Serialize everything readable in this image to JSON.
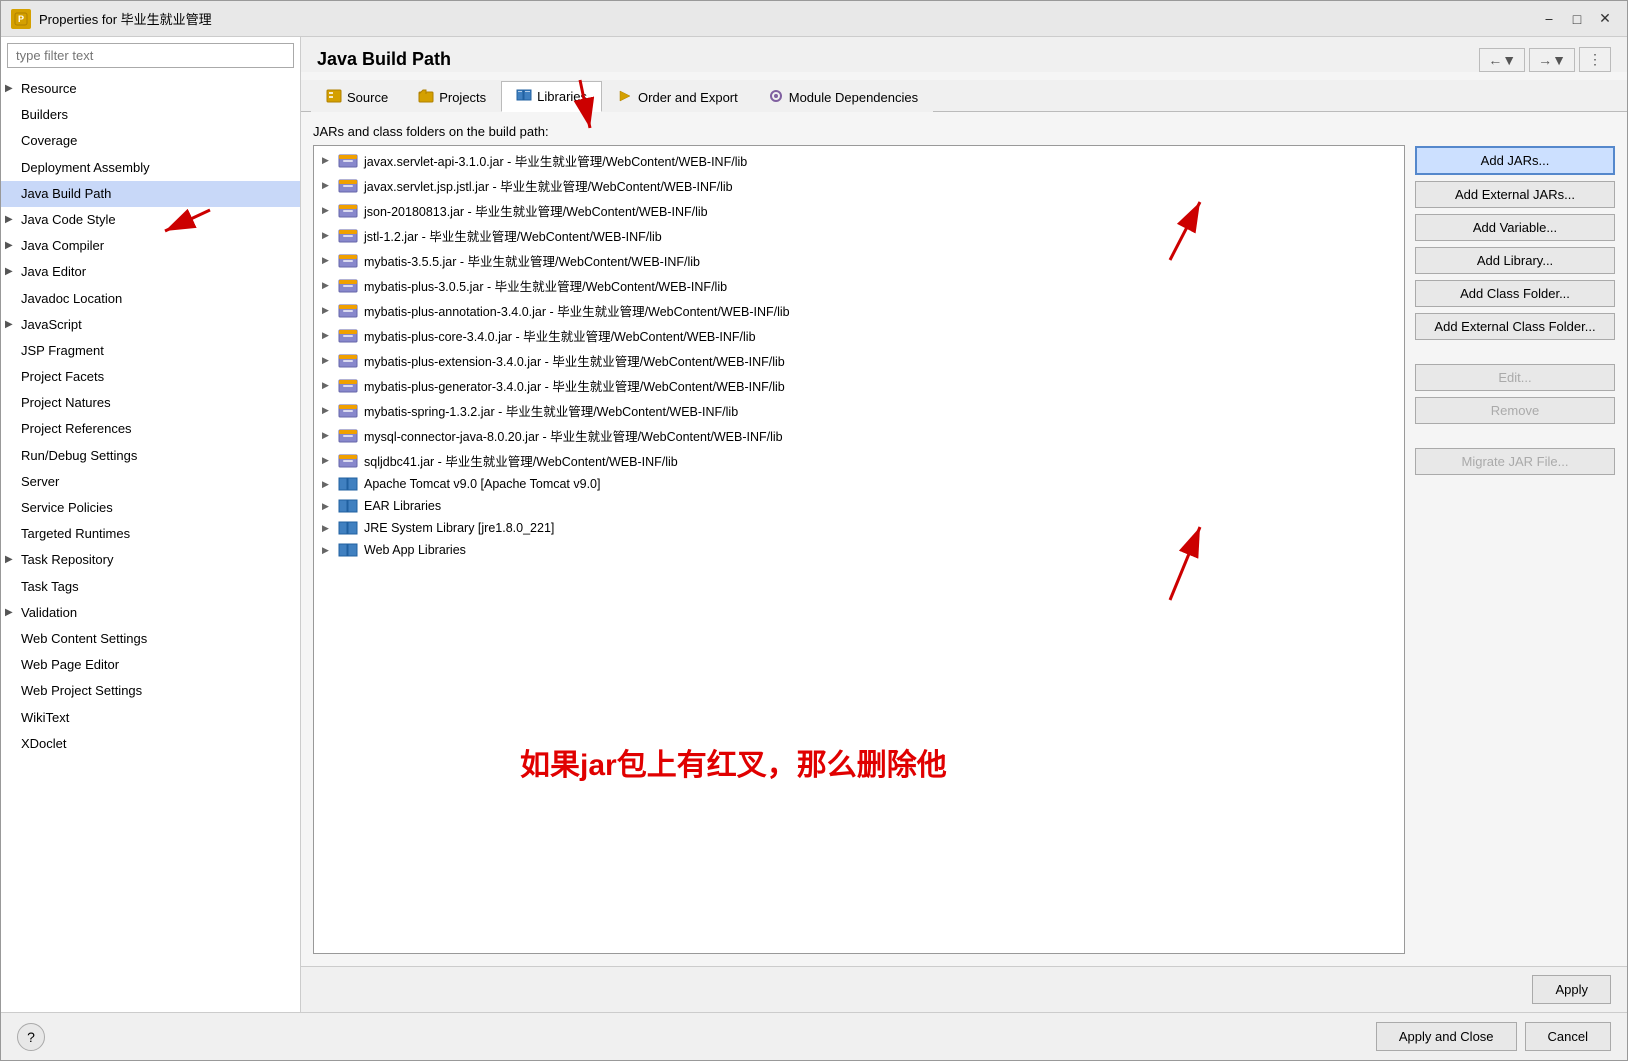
{
  "window": {
    "title": "Properties for 毕业生就业管理",
    "icon": "P"
  },
  "filter": {
    "placeholder": "type filter text"
  },
  "sidebar": {
    "items": [
      {
        "label": "Resource",
        "arrow": true,
        "selected": false
      },
      {
        "label": "Builders",
        "arrow": false,
        "selected": false
      },
      {
        "label": "Coverage",
        "arrow": false,
        "selected": false
      },
      {
        "label": "Deployment Assembly",
        "arrow": false,
        "selected": false
      },
      {
        "label": "Java Build Path",
        "arrow": false,
        "selected": true
      },
      {
        "label": "Java Code Style",
        "arrow": true,
        "selected": false
      },
      {
        "label": "Java Compiler",
        "arrow": true,
        "selected": false
      },
      {
        "label": "Java Editor",
        "arrow": true,
        "selected": false
      },
      {
        "label": "Javadoc Location",
        "arrow": false,
        "selected": false
      },
      {
        "label": "JavaScript",
        "arrow": true,
        "selected": false
      },
      {
        "label": "JSP Fragment",
        "arrow": false,
        "selected": false
      },
      {
        "label": "Project Facets",
        "arrow": false,
        "selected": false
      },
      {
        "label": "Project Natures",
        "arrow": false,
        "selected": false
      },
      {
        "label": "Project References",
        "arrow": false,
        "selected": false
      },
      {
        "label": "Run/Debug Settings",
        "arrow": false,
        "selected": false
      },
      {
        "label": "Server",
        "arrow": false,
        "selected": false
      },
      {
        "label": "Service Policies",
        "arrow": false,
        "selected": false
      },
      {
        "label": "Targeted Runtimes",
        "arrow": false,
        "selected": false
      },
      {
        "label": "Task Repository",
        "arrow": true,
        "selected": false
      },
      {
        "label": "Task Tags",
        "arrow": false,
        "selected": false
      },
      {
        "label": "Validation",
        "arrow": true,
        "selected": false
      },
      {
        "label": "Web Content Settings",
        "arrow": false,
        "selected": false
      },
      {
        "label": "Web Page Editor",
        "arrow": false,
        "selected": false
      },
      {
        "label": "Web Project Settings",
        "arrow": false,
        "selected": false
      },
      {
        "label": "WikiText",
        "arrow": false,
        "selected": false
      },
      {
        "label": "XDoclet",
        "arrow": false,
        "selected": false
      }
    ]
  },
  "panel": {
    "title": "Java Build Path",
    "tabs": [
      {
        "label": "Source",
        "icon": "source",
        "active": false
      },
      {
        "label": "Projects",
        "icon": "projects",
        "active": false
      },
      {
        "label": "Libraries",
        "icon": "libraries",
        "active": true
      },
      {
        "label": "Order and Export",
        "icon": "order",
        "active": false
      },
      {
        "label": "Module Dependencies",
        "icon": "module",
        "active": false
      }
    ],
    "lib_label": "JARs and class folders on the build path:",
    "libraries": [
      {
        "type": "jar",
        "label": "javax.servlet-api-3.1.0.jar - 毕业生就业管理/WebContent/WEB-INF/lib"
      },
      {
        "type": "jar",
        "label": "javax.servlet.jsp.jstl.jar - 毕业生就业管理/WebContent/WEB-INF/lib"
      },
      {
        "type": "jar",
        "label": "json-20180813.jar - 毕业生就业管理/WebContent/WEB-INF/lib"
      },
      {
        "type": "jar",
        "label": "jstl-1.2.jar - 毕业生就业管理/WebContent/WEB-INF/lib"
      },
      {
        "type": "jar",
        "label": "mybatis-3.5.5.jar - 毕业生就业管理/WebContent/WEB-INF/lib"
      },
      {
        "type": "jar",
        "label": "mybatis-plus-3.0.5.jar - 毕业生就业管理/WebContent/WEB-INF/lib"
      },
      {
        "type": "jar",
        "label": "mybatis-plus-annotation-3.4.0.jar - 毕业生就业管理/WebContent/WEB-INF/lib"
      },
      {
        "type": "jar",
        "label": "mybatis-plus-core-3.4.0.jar - 毕业生就业管理/WebContent/WEB-INF/lib"
      },
      {
        "type": "jar",
        "label": "mybatis-plus-extension-3.4.0.jar - 毕业生就业管理/WebContent/WEB-INF/lib"
      },
      {
        "type": "jar",
        "label": "mybatis-plus-generator-3.4.0.jar - 毕业生就业管理/WebContent/WEB-INF/lib"
      },
      {
        "type": "jar",
        "label": "mybatis-spring-1.3.2.jar - 毕业生就业管理/WebContent/WEB-INF/lib"
      },
      {
        "type": "jar",
        "label": "mysql-connector-java-8.0.20.jar - 毕业生就业管理/WebContent/WEB-INF/lib"
      },
      {
        "type": "jar",
        "label": "sqljdbc41.jar - 毕业生就业管理/WebContent/WEB-INF/lib"
      },
      {
        "type": "syslib",
        "label": "Apache Tomcat v9.0 [Apache Tomcat v9.0]"
      },
      {
        "type": "syslib",
        "label": "EAR Libraries"
      },
      {
        "type": "syslib",
        "label": "JRE System Library [jre1.8.0_221]"
      },
      {
        "type": "syslib",
        "label": "Web App Libraries"
      }
    ],
    "buttons": [
      {
        "label": "Add JARs...",
        "primary": true,
        "disabled": false,
        "id": "add-jars"
      },
      {
        "label": "Add External JARs...",
        "primary": false,
        "disabled": false,
        "id": "add-external-jars"
      },
      {
        "label": "Add Variable...",
        "primary": false,
        "disabled": false,
        "id": "add-variable"
      },
      {
        "label": "Add Library...",
        "primary": false,
        "disabled": false,
        "id": "add-library"
      },
      {
        "label": "Add Class Folder...",
        "primary": false,
        "disabled": false,
        "id": "add-class-folder"
      },
      {
        "label": "Add External Class Folder...",
        "primary": false,
        "disabled": false,
        "id": "add-ext-class-folder"
      },
      {
        "label": "Edit...",
        "primary": false,
        "disabled": true,
        "id": "edit"
      },
      {
        "label": "Remove",
        "primary": false,
        "disabled": true,
        "id": "remove"
      },
      {
        "label": "Migrate JAR File...",
        "primary": false,
        "disabled": true,
        "id": "migrate"
      }
    ],
    "apply_label": "Apply"
  },
  "footer": {
    "help_label": "?",
    "apply_close_label": "Apply and Close",
    "cancel_label": "Cancel"
  },
  "annotation": {
    "text": "如果jar包上有红叉，那么删除他"
  }
}
